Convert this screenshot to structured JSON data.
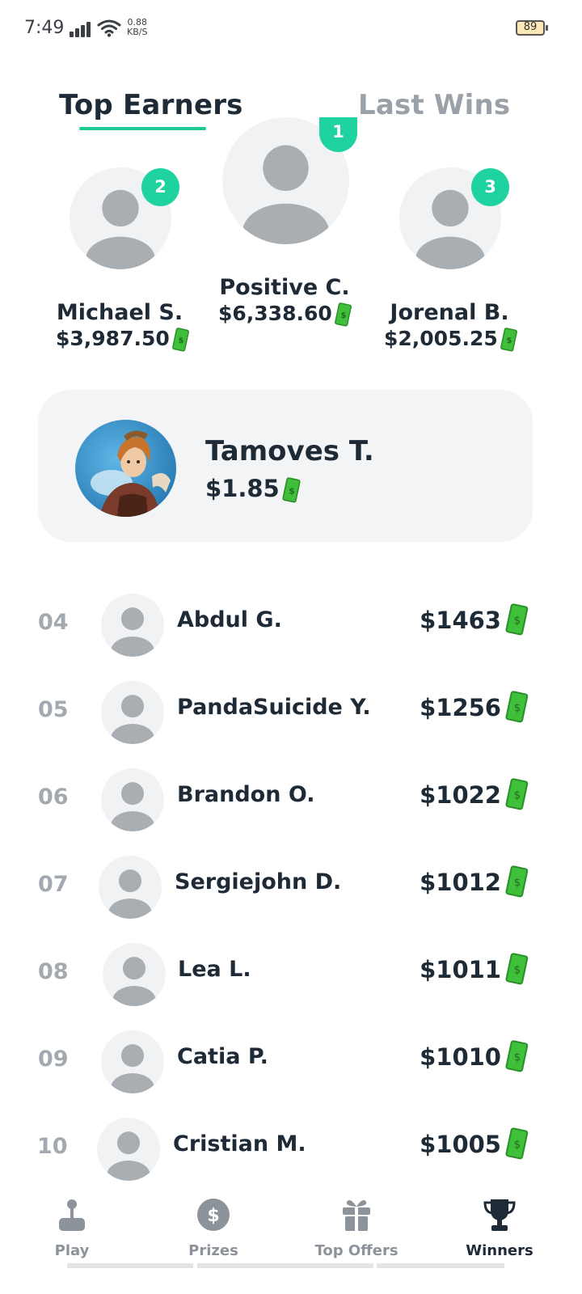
{
  "status_bar": {
    "time": "7:49",
    "net_speed_value": "0.88",
    "net_speed_unit": "KB/S",
    "battery": "89"
  },
  "tabs": [
    {
      "label": "Top Earners",
      "active": true
    },
    {
      "label": "Last Wins",
      "active": false
    }
  ],
  "podium": [
    {
      "rank": "2",
      "name": "Michael S.",
      "amount": "$3,987.50"
    },
    {
      "rank": "1",
      "name": "Positive C.",
      "amount": "$6,338.60"
    },
    {
      "rank": "3",
      "name": "Jorenal B.",
      "amount": "$2,005.25"
    }
  ],
  "me": {
    "name": "Tamoves T.",
    "amount": "$1.85"
  },
  "leaderboard": [
    {
      "rank": "04",
      "name": "Abdul G.",
      "amount": "$1463"
    },
    {
      "rank": "05",
      "name": "PandaSuicide Y.",
      "amount": "$1256"
    },
    {
      "rank": "06",
      "name": "Brandon O.",
      "amount": "$1022"
    },
    {
      "rank": "07",
      "name": "Sergiejohn D.",
      "amount": "$1012"
    },
    {
      "rank": "08",
      "name": "Lea L.",
      "amount": "$1011"
    },
    {
      "rank": "09",
      "name": "Catia P.",
      "amount": "$1010"
    },
    {
      "rank": "10",
      "name": "Cristian M.",
      "amount": "$1005"
    }
  ],
  "nav": [
    {
      "label": "Play",
      "icon": "joystick-icon",
      "active": false
    },
    {
      "label": "Prizes",
      "icon": "dollar-coin-icon",
      "active": false
    },
    {
      "label": "Top Offers",
      "icon": "gift-icon",
      "active": false
    },
    {
      "label": "Winners",
      "icon": "trophy-icon",
      "active": true
    }
  ],
  "colors": {
    "accent": "#1ed39f",
    "text_dark": "#1e2a36",
    "text_muted": "#9aa1a9",
    "card_bg": "#f3f4f6",
    "cash_green": "#3fbf3a"
  }
}
